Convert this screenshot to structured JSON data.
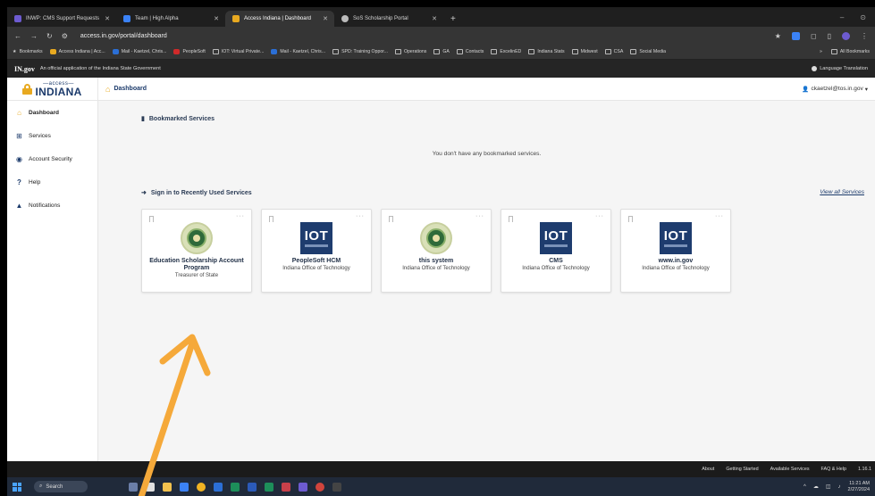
{
  "browser": {
    "tabs": [
      {
        "label": "INWP: CMS Support Requests",
        "color": "#6d5bd0"
      },
      {
        "label": "Team | High Alpha",
        "color": "#3b82f6"
      },
      {
        "label": "Access Indiana | Dashboard",
        "color": "#e8a920"
      },
      {
        "label": "SoS Scholarship Portal",
        "color": "#bbbbbb"
      }
    ],
    "url": "access.in.gov/portal/dashboard",
    "bookmarks": [
      "Bookmarks",
      "Access Indiana | Acc...",
      "Mail - Kaetzel, Chris...",
      "PeopleSoft",
      "IOT: Virtual Private...",
      "Mail - Kaetzel, Chris...",
      "SPD: Training Oppor...",
      "Operations",
      "GA",
      "Contacts",
      "ExcelinED",
      "Indiana Stats",
      "Midwest",
      "CSA",
      "Social Media"
    ],
    "all_bookmarks": "All Bookmarks"
  },
  "ingov": {
    "logo_prefix": "IN.",
    "logo_suffix": "gov",
    "tagline": "An official application of the Indiana State Government",
    "language": "Language Translation"
  },
  "brand": {
    "access": "—access—",
    "indiana": "INDIANA"
  },
  "sidebar": {
    "items": [
      {
        "label": "Dashboard",
        "icon": "home-icon"
      },
      {
        "label": "Services",
        "icon": "grid-icon"
      },
      {
        "label": "Account Security",
        "icon": "shield-icon"
      },
      {
        "label": "Help",
        "icon": "question-icon"
      },
      {
        "label": "Notifications",
        "icon": "bell-icon"
      }
    ]
  },
  "topbar": {
    "crumb": "Dashboard",
    "user": "ckaetzel@tos.in.gov"
  },
  "main": {
    "bookmarked_title": "Bookmarked Services",
    "empty_message": "You don't have any bookmarked services.",
    "recent_title": "Sign in to Recently Used Services",
    "view_all": "View all Services",
    "cards": [
      {
        "title": "Education Scholarship Account Program",
        "subtitle": "Treasurer of State",
        "logo": "seal"
      },
      {
        "title": "PeopleSoft HCM",
        "subtitle": "Indiana Office of Technology",
        "logo": "iot"
      },
      {
        "title": "this system",
        "subtitle": "Indiana Office of Technology",
        "logo": "seal"
      },
      {
        "title": "CMS",
        "subtitle": "Indiana Office of Technology",
        "logo": "iot"
      },
      {
        "title": "www.in.gov",
        "subtitle": "Indiana Office of Technology",
        "logo": "iot"
      }
    ],
    "iot_text": "IOT"
  },
  "footer": {
    "links": [
      "About",
      "Getting Started",
      "Available Services",
      "FAQ & Help"
    ],
    "version": "1.16.1"
  },
  "taskbar": {
    "search": "Search",
    "time": "11:21 AM",
    "date": "2/27/2024"
  },
  "colors": {
    "brand_navy": "#1b3a6b",
    "brand_gold": "#e8a920",
    "annotation_arrow": "#f5a93a"
  }
}
